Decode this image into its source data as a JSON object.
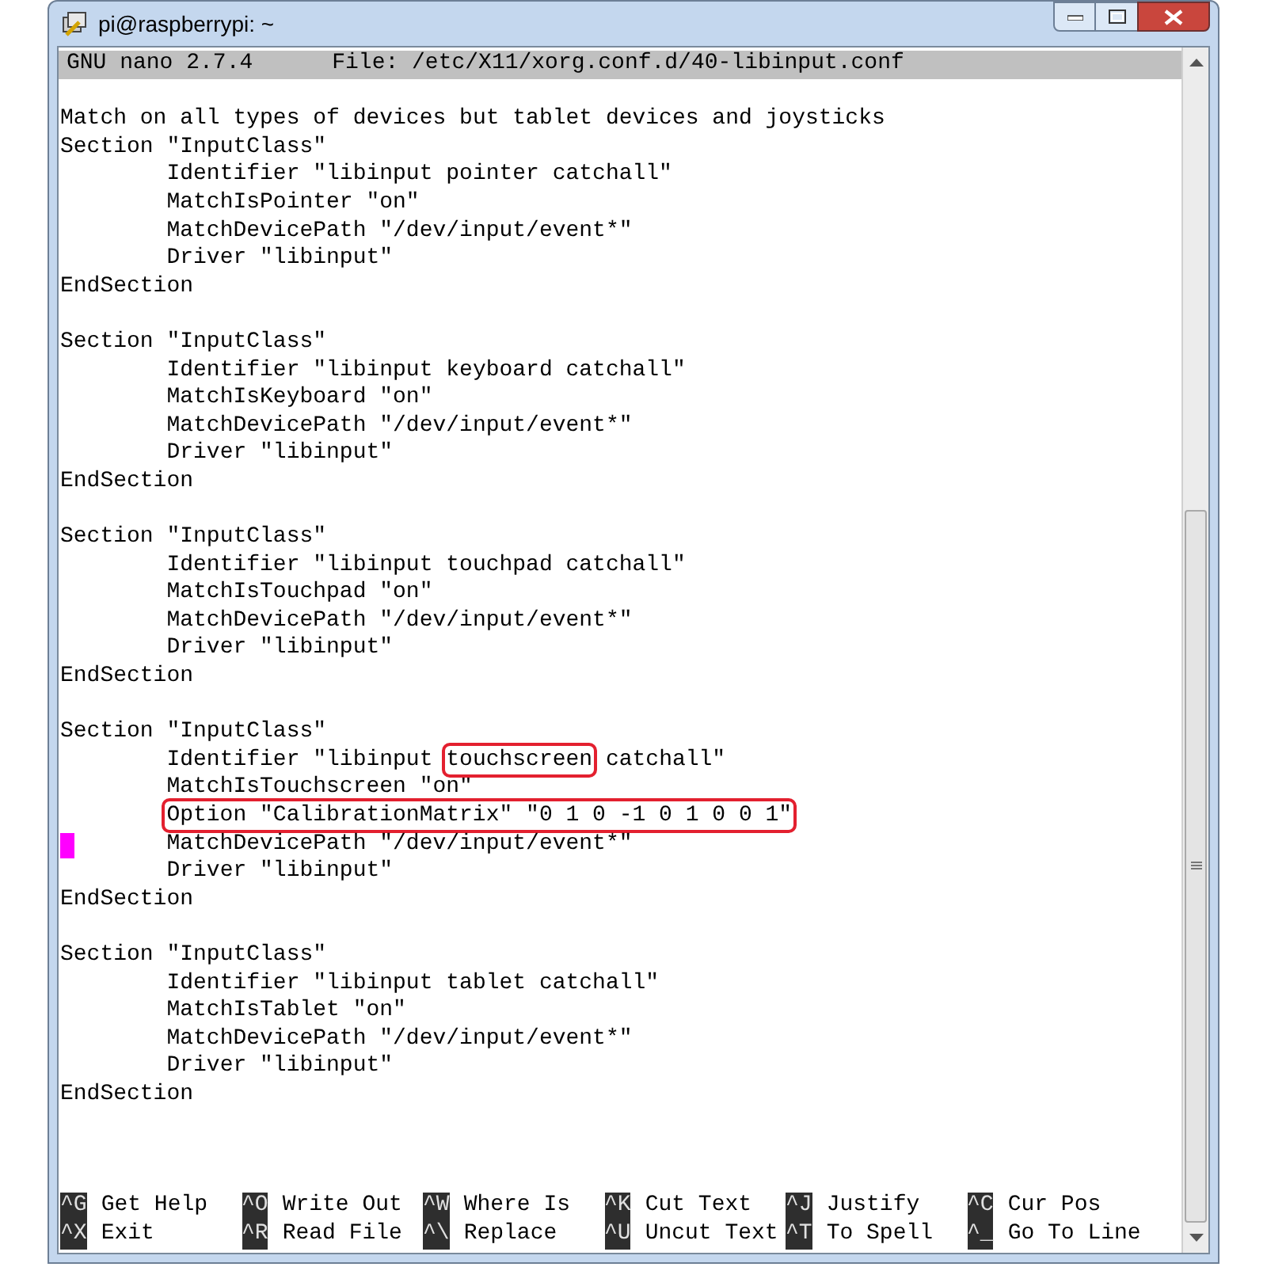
{
  "window": {
    "title": "pi@raspberrypi: ~"
  },
  "header": {
    "app": "GNU nano 2.7.4",
    "file": "File: /etc/X11/xorg.conf.d/40-libinput.conf"
  },
  "lines": [
    {
      "kind": "blank"
    },
    {
      "kind": "text",
      "text": "Match on all types of devices but tablet devices and joysticks"
    },
    {
      "kind": "text",
      "text": "Section \"InputClass\""
    },
    {
      "kind": "text",
      "text": "        Identifier \"libinput pointer catchall\""
    },
    {
      "kind": "text",
      "text": "        MatchIsPointer \"on\""
    },
    {
      "kind": "text",
      "text": "        MatchDevicePath \"/dev/input/event*\""
    },
    {
      "kind": "text",
      "text": "        Driver \"libinput\""
    },
    {
      "kind": "text",
      "text": "EndSection"
    },
    {
      "kind": "blank"
    },
    {
      "kind": "text",
      "text": "Section \"InputClass\""
    },
    {
      "kind": "text",
      "text": "        Identifier \"libinput keyboard catchall\""
    },
    {
      "kind": "text",
      "text": "        MatchIsKeyboard \"on\""
    },
    {
      "kind": "text",
      "text": "        MatchDevicePath \"/dev/input/event*\""
    },
    {
      "kind": "text",
      "text": "        Driver \"libinput\""
    },
    {
      "kind": "text",
      "text": "EndSection"
    },
    {
      "kind": "blank"
    },
    {
      "kind": "text",
      "text": "Section \"InputClass\""
    },
    {
      "kind": "text",
      "text": "        Identifier \"libinput touchpad catchall\""
    },
    {
      "kind": "text",
      "text": "        MatchIsTouchpad \"on\""
    },
    {
      "kind": "text",
      "text": "        MatchDevicePath \"/dev/input/event*\""
    },
    {
      "kind": "text",
      "text": "        Driver \"libinput\""
    },
    {
      "kind": "text",
      "text": "EndSection"
    },
    {
      "kind": "blank"
    },
    {
      "kind": "text",
      "text": "Section \"InputClass\""
    },
    {
      "kind": "segments",
      "parts": [
        {
          "text": "        Identifier \"libinput ",
          "boxed": false
        },
        {
          "text": "touchscreen",
          "boxed": true
        },
        {
          "text": " catchall\"",
          "boxed": false
        }
      ]
    },
    {
      "kind": "text",
      "text": "        MatchIsTouchscreen \"on\""
    },
    {
      "kind": "segments",
      "indented": true,
      "parts": [
        {
          "text": "Option \"CalibrationMatrix\" \"0 1 0 -1 0 1 0 0 1\"",
          "boxed": true
        }
      ]
    },
    {
      "kind": "cursor",
      "indented": true,
      "text": "MatchDevicePath \"/dev/input/event*\""
    },
    {
      "kind": "text",
      "text": "        Driver \"libinput\""
    },
    {
      "kind": "text",
      "text": "EndSection"
    },
    {
      "kind": "blank"
    },
    {
      "kind": "text",
      "text": "Section \"InputClass\""
    },
    {
      "kind": "text",
      "text": "        Identifier \"libinput tablet catchall\""
    },
    {
      "kind": "text",
      "text": "        MatchIsTablet \"on\""
    },
    {
      "kind": "text",
      "text": "        MatchDevicePath \"/dev/input/event*\""
    },
    {
      "kind": "text",
      "text": "        Driver \"libinput\""
    },
    {
      "kind": "text",
      "text": "EndSection"
    },
    {
      "kind": "blank"
    },
    {
      "kind": "blank"
    },
    {
      "kind": "blank"
    }
  ],
  "shortcuts": [
    [
      {
        "key": "^G",
        "label": "Get Help"
      },
      {
        "key": "^O",
        "label": "Write Out"
      },
      {
        "key": "^W",
        "label": "Where Is"
      },
      {
        "key": "^K",
        "label": "Cut Text"
      },
      {
        "key": "^J",
        "label": "Justify"
      },
      {
        "key": "^C",
        "label": "Cur Pos"
      }
    ],
    [
      {
        "key": "^X",
        "label": "Exit"
      },
      {
        "key": "^R",
        "label": "Read File"
      },
      {
        "key": "^\\",
        "label": "Replace"
      },
      {
        "key": "^U",
        "label": "Uncut Text"
      },
      {
        "key": "^T",
        "label": "To Spell"
      },
      {
        "key": "^_",
        "label": "Go To Line"
      }
    ]
  ]
}
